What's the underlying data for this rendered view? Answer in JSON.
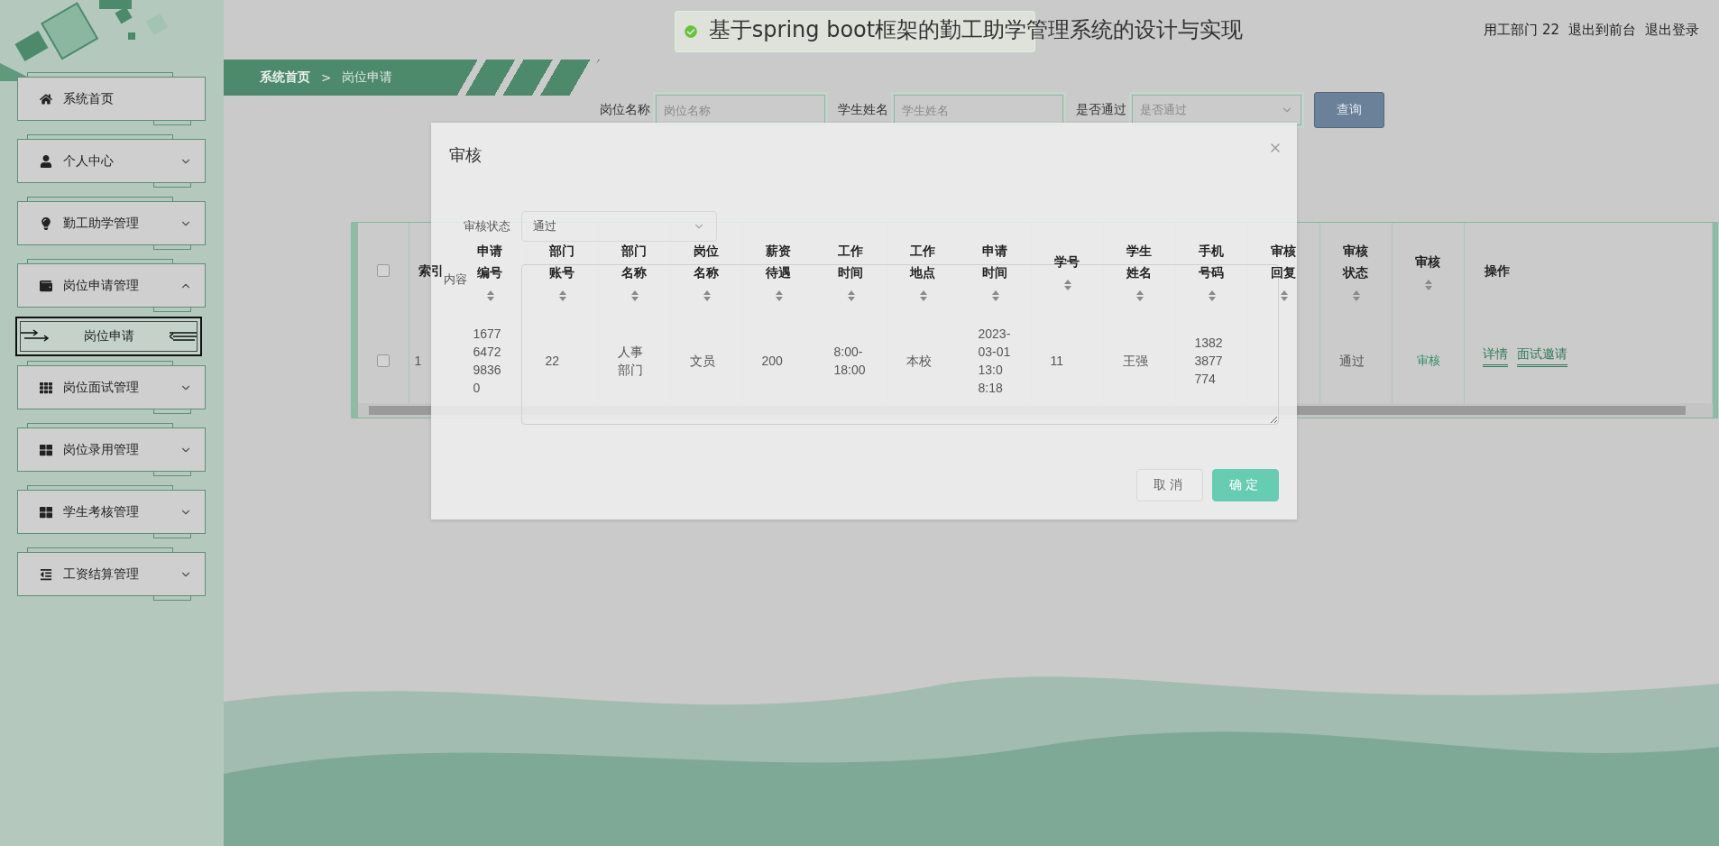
{
  "header": {
    "title": "基于spring boot框架的勤工助学管理系统的设计与实现",
    "user": "用工部门 22",
    "links": [
      "退出到前台",
      "退出登录"
    ]
  },
  "toast": {
    "kind": "success"
  },
  "sidebar": {
    "items": [
      {
        "label": "系统首页",
        "kind": "home"
      },
      {
        "label": "个人中心",
        "kind": "user",
        "expanded": false
      },
      {
        "label": "勤工助学管理",
        "kind": "bulb",
        "expanded": false
      },
      {
        "label": "岗位申请管理",
        "kind": "wallet",
        "expanded": true,
        "children": [
          {
            "label": "岗位申请",
            "selected": true
          }
        ]
      },
      {
        "label": "岗位面试管理",
        "kind": "grid9",
        "expanded": false
      },
      {
        "label": "岗位录用管理",
        "kind": "grid4",
        "expanded": false
      },
      {
        "label": "学生考核管理",
        "kind": "grid4",
        "expanded": false
      },
      {
        "label": "工资结算管理",
        "kind": "outdent",
        "expanded": false
      }
    ]
  },
  "breadcrumb": {
    "items": [
      "系统首页",
      "岗位申请"
    ],
    "separator": ">"
  },
  "search": {
    "fields": [
      {
        "label": "岗位名称",
        "placeholder": "岗位名称",
        "kind": "input"
      },
      {
        "label": "学生姓名",
        "placeholder": "学生姓名",
        "kind": "input"
      },
      {
        "label": "是否通过",
        "placeholder": "是否通过",
        "kind": "select"
      }
    ],
    "button": "查询"
  },
  "table": {
    "select_all": {
      "checked": false
    },
    "columns": [
      {
        "label": "索引",
        "kind": "text",
        "sortable": false
      },
      {
        "label": "申请编号",
        "kind": "text",
        "sortable": true
      },
      {
        "label": "部门账号",
        "kind": "text",
        "sortable": true
      },
      {
        "label": "部门名称",
        "kind": "text",
        "sortable": true
      },
      {
        "label": "岗位名称",
        "kind": "text",
        "sortable": true
      },
      {
        "label": "薪资待遇",
        "kind": "text",
        "sortable": true
      },
      {
        "label": "工作时间",
        "kind": "text",
        "sortable": true
      },
      {
        "label": "工作地点",
        "kind": "text",
        "sortable": true
      },
      {
        "label": "申请时间",
        "kind": "text",
        "sortable": true
      },
      {
        "label": "学号",
        "kind": "text",
        "sortable": true
      },
      {
        "label": "学生姓名",
        "kind": "text",
        "sortable": true
      },
      {
        "label": "手机号码",
        "kind": "text",
        "sortable": true
      },
      {
        "label": "审核回复",
        "kind": "text",
        "sortable": true
      },
      {
        "label": "审核状态",
        "kind": "text",
        "sortable": true
      },
      {
        "label": "审核",
        "kind": "link",
        "sortable": true
      },
      {
        "label": "操作",
        "kind": "actions",
        "sortable": false
      }
    ],
    "rows": [
      {
        "checked": false,
        "cells": [
          "1",
          "1677647298360",
          "22",
          "人事部门",
          "文员",
          "200",
          "8:00-18:00",
          "本校",
          "2023-03-01 13:08:18",
          "11",
          "王强",
          "13823877774",
          null,
          "通过",
          "审核",
          [
            "详情",
            "面试邀请"
          ]
        ]
      }
    ]
  },
  "dialog": {
    "title": "审核",
    "fields": [
      {
        "label": "审核状态",
        "kind": "select",
        "value": "通过"
      },
      {
        "label": "内容",
        "kind": "textarea"
      }
    ],
    "buttons": [
      {
        "label": "取消",
        "kind": "default"
      },
      {
        "label": "确定",
        "kind": "primary"
      }
    ]
  }
}
